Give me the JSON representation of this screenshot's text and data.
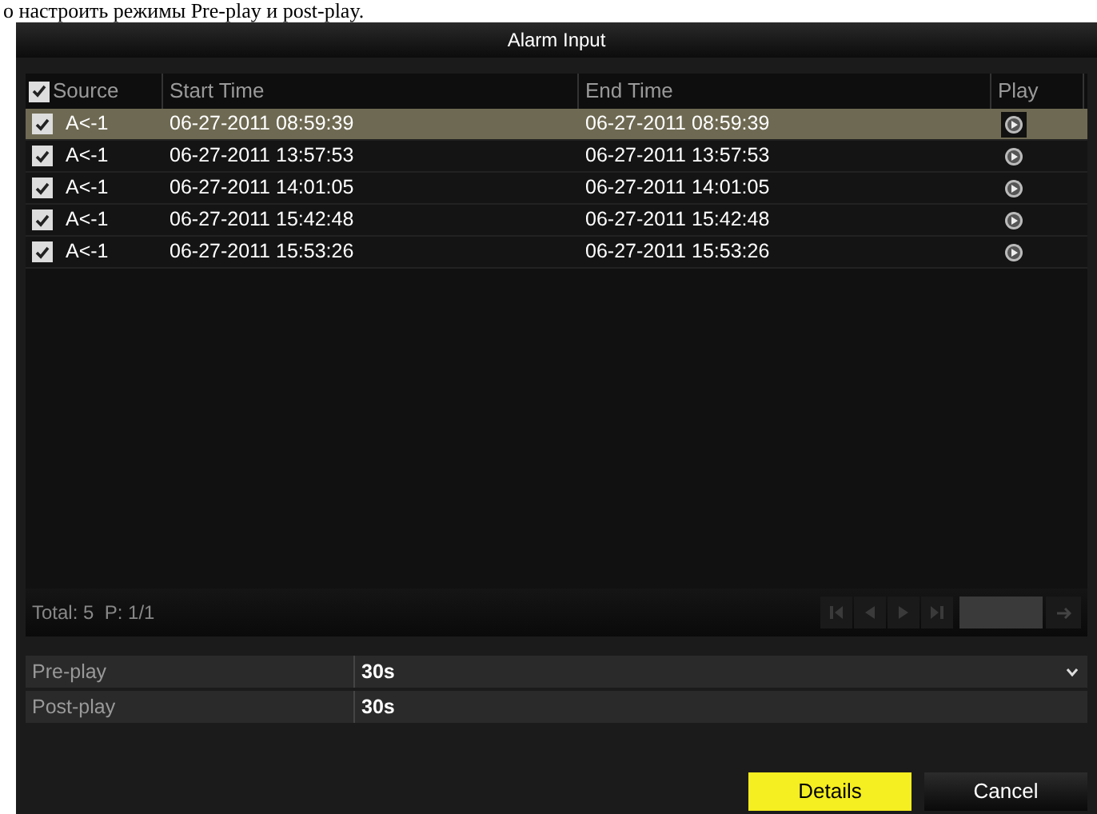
{
  "caption": "о настроить режимы Pre-play и post-play.",
  "window": {
    "title": "Alarm Input"
  },
  "table": {
    "select_all_checked": true,
    "columns": [
      "Source",
      "Start Time",
      "End Time",
      "Play"
    ],
    "rows": [
      {
        "source": "A<-1",
        "start": "06-27-2011 08:59:39",
        "end": "06-27-2011 08:59:39",
        "checked": true,
        "selected": true
      },
      {
        "source": "A<-1",
        "start": "06-27-2011 13:57:53",
        "end": "06-27-2011 13:57:53",
        "checked": true,
        "selected": false
      },
      {
        "source": "A<-1",
        "start": "06-27-2011 14:01:05",
        "end": "06-27-2011 14:01:05",
        "checked": true,
        "selected": false
      },
      {
        "source": "A<-1",
        "start": "06-27-2011 15:42:48",
        "end": "06-27-2011 15:42:48",
        "checked": true,
        "selected": false
      },
      {
        "source": "A<-1",
        "start": "06-27-2011 15:53:26",
        "end": "06-27-2011 15:53:26",
        "checked": true,
        "selected": false
      }
    ]
  },
  "pager": {
    "total": "Total: 5  P: 1/1"
  },
  "settings": [
    {
      "label": "Pre-play",
      "value": "30s",
      "kind": "dropdown"
    },
    {
      "label": "Post-play",
      "value": "30s",
      "kind": "text"
    }
  ],
  "buttons": [
    {
      "label": "Details",
      "primary": true
    },
    {
      "label": "Cancel",
      "primary": false
    }
  ]
}
